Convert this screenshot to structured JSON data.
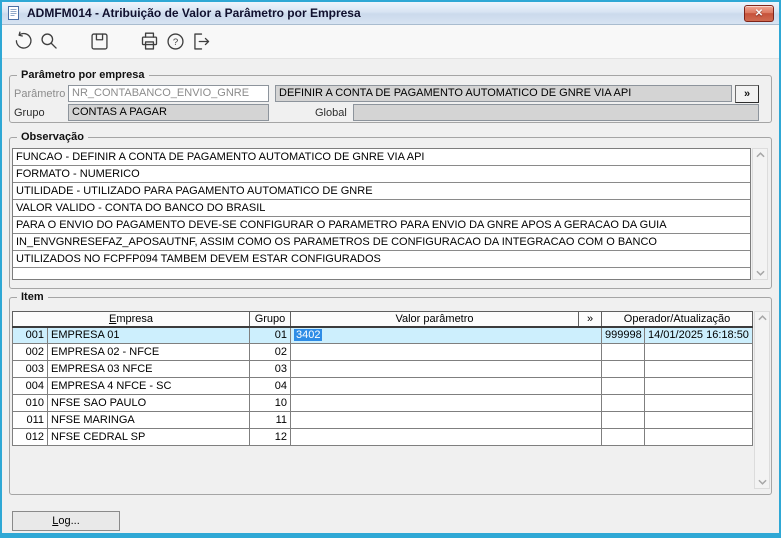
{
  "window": {
    "title": "ADMFM014 - Atribuição de Valor a Parâmetro por Empresa",
    "close_glyph": "✕"
  },
  "toolbar": {
    "icons": [
      "undo",
      "search",
      "save",
      "print",
      "help",
      "exit"
    ]
  },
  "parametro_group": {
    "title": "Parâmetro por empresa",
    "parametro_label": "Parâmetro",
    "parametro_value": "NR_CONTABANCO_ENVIO_GNRE",
    "parametro_descricao": "DEFINIR A CONTA DE PAGAMENTO AUTOMATICO DE GNRE VIA API",
    "expand_button": "»",
    "grupo_label": "Grupo",
    "grupo_value": "CONTAS A PAGAR",
    "global_label": "Global",
    "global_value": ""
  },
  "observacao": {
    "title": "Observação",
    "lines": [
      "FUNCAO - DEFINIR A CONTA DE PAGAMENTO AUTOMATICO DE GNRE VIA API",
      "FORMATO - NUMERICO",
      "UTILIDADE - UTILIZADO PARA PAGAMENTO AUTOMATICO DE GNRE",
      "VALOR VALIDO - CONTA DO BANCO DO BRASIL",
      "PARA O ENVIO DO PAGAMENTO DEVE-SE CONFIGURAR O PARAMETRO PARA ENVIO DA GNRE APOS A GERACAO DA GUIA",
      "IN_ENVGNRESEFAZ_APOSAUTNF, ASSIM COMO OS PARAMETROS DE CONFIGURACAO DA INTEGRACAO COM O BANCO",
      "UTILIZADOS NO FCPFP094 TAMBEM DEVEM ESTAR CONFIGURADOS"
    ]
  },
  "item": {
    "title": "Item",
    "columns": {
      "empresa_accel": "E",
      "empresa_rest": "mpresa",
      "grupo": "Grupo",
      "valor": "Valor parâmetro",
      "expand": "»",
      "operador": "Operador/Atualização"
    },
    "rows": [
      {
        "num": "001",
        "empresa": "EMPRESA 01",
        "grupo": "01",
        "valor": "3402",
        "operador": "999998",
        "atualizacao": "14/01/2025 16:18:50"
      },
      {
        "num": "002",
        "empresa": "EMPRESA 02 - NFCE",
        "grupo": "02",
        "valor": "",
        "operador": "",
        "atualizacao": ""
      },
      {
        "num": "003",
        "empresa": "EMPRESA 03 NFCE",
        "grupo": "03",
        "valor": "",
        "operador": "",
        "atualizacao": ""
      },
      {
        "num": "004",
        "empresa": "EMPRESA 4 NFCE - SC",
        "grupo": "04",
        "valor": "",
        "operador": "",
        "atualizacao": ""
      },
      {
        "num": "010",
        "empresa": "NFSE SAO PAULO",
        "grupo": "10",
        "valor": "",
        "operador": "",
        "atualizacao": ""
      },
      {
        "num": "011",
        "empresa": "NFSE MARINGA",
        "grupo": "11",
        "valor": "",
        "operador": "",
        "atualizacao": ""
      },
      {
        "num": "012",
        "empresa": "NFSE CEDRAL SP",
        "grupo": "12",
        "valor": "",
        "operador": "",
        "atualizacao": ""
      }
    ]
  },
  "footer": {
    "log_accel": "L",
    "log_rest": "og..."
  },
  "colors": {
    "window_border": "#2fa8d5",
    "close_button": "#c6523a",
    "selected_row": "#cdeffd",
    "selection": "#2e8ce6",
    "readonly_field": "#d4d4d4",
    "disabled_cell": "#d9d9d9"
  }
}
